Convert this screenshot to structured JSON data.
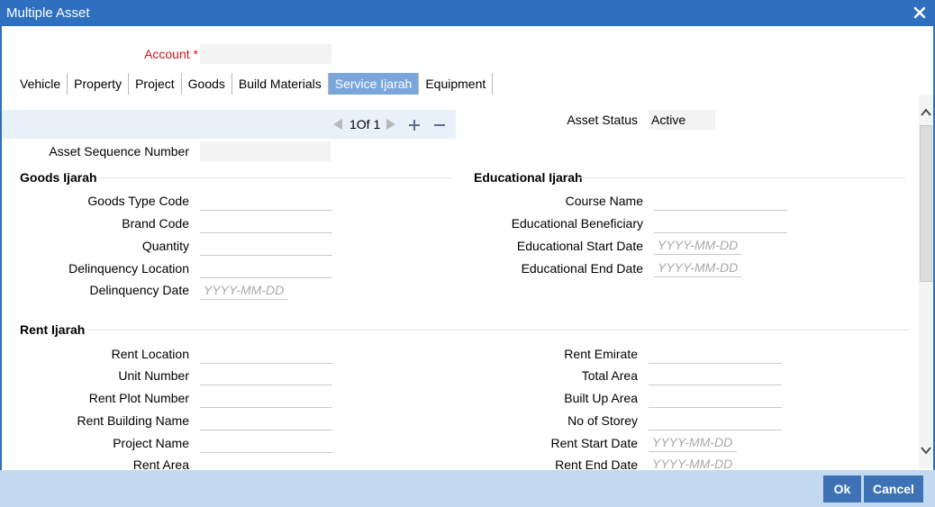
{
  "window": {
    "title": "Multiple Asset"
  },
  "account": {
    "label": "Account",
    "required_mark": "*",
    "value": ""
  },
  "tabs": [
    {
      "label": "Vehicle"
    },
    {
      "label": "Property"
    },
    {
      "label": "Project"
    },
    {
      "label": "Goods"
    },
    {
      "label": "Build Materials"
    },
    {
      "label": "Service Ijarah",
      "active": true
    },
    {
      "label": "Equipment"
    }
  ],
  "pager": {
    "current": "1",
    "of_label": "Of",
    "total": "1"
  },
  "asset_status": {
    "label": "Asset Status",
    "value": "Active"
  },
  "asset_sequence": {
    "label": "Asset Sequence Number",
    "value": ""
  },
  "goods_ijarah": {
    "heading": "Goods Ijarah",
    "goods_type_code": "Goods Type Code",
    "brand_code": "Brand Code",
    "quantity": "Quantity",
    "delinquency_location": "Delinquency Location",
    "delinquency_date": "Delinquency Date",
    "date_placeholder": "YYYY-MM-DD"
  },
  "educational_ijarah": {
    "heading": "Educational Ijarah",
    "course_name": "Course Name",
    "beneficiary": "Educational Beneficiary",
    "start_date": "Educational Start Date",
    "end_date": "Educational End Date",
    "date_placeholder": "YYYY-MM-DD"
  },
  "rent_ijarah": {
    "heading": "Rent Ijarah",
    "rent_location": "Rent Location",
    "unit_number": "Unit Number",
    "rent_plot_number": "Rent Plot Number",
    "rent_building_name": "Rent Building Name",
    "project_name": "Project Name",
    "rent_area": "Rent Area",
    "rent_emirate": "Rent Emirate",
    "total_area": "Total Area",
    "built_up_area": "Built Up Area",
    "no_of_storey": "No of Storey",
    "rent_start_date": "Rent Start Date",
    "rent_end_date": "Rent End Date",
    "date_placeholder": "YYYY-MM-DD"
  },
  "footer": {
    "ok_label": "Ok",
    "cancel_label": "Cancel"
  },
  "colors": {
    "titlebar": "#2f6fc0",
    "active_tab": "#7aa6dc",
    "footer": "#c1daf0",
    "button": "#3f72b4",
    "required": "#d6141b"
  },
  "icons": {
    "close": "close-icon",
    "prev": "prev-triangle-icon",
    "next": "next-triangle-icon",
    "add": "plus-icon",
    "remove": "minus-icon",
    "scroll_up": "chevron-up-icon",
    "scroll_down": "chevron-down-icon"
  }
}
